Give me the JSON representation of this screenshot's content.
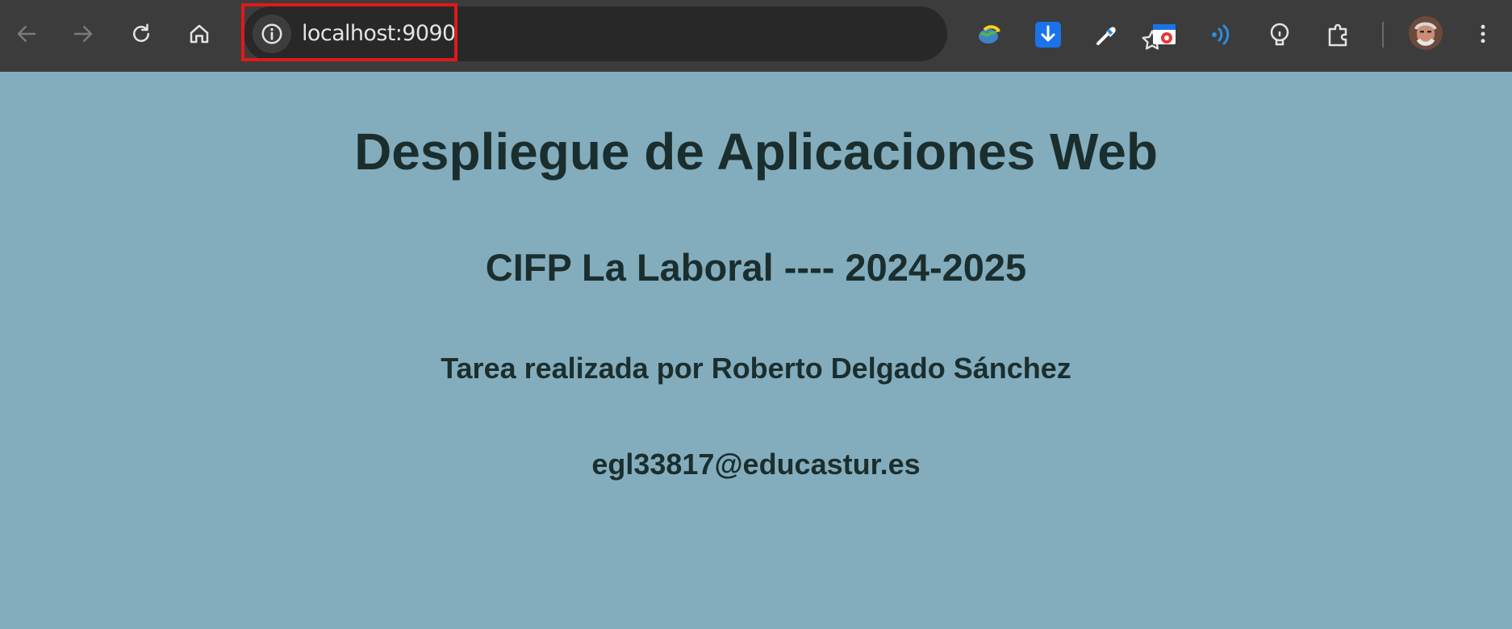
{
  "browser": {
    "url": "localhost:9090",
    "icons": {
      "back": "arrow-left-icon",
      "forward": "arrow-right-icon",
      "reload": "reload-icon",
      "home": "home-icon",
      "site_info": "info-icon",
      "bookmark": "star-icon",
      "extensions": [
        "globe-arrow-icon",
        "download-icon",
        "eyedropper-icon",
        "calendar-gear-icon",
        "wireless-icon",
        "lightbulb-icon",
        "puzzle-icon"
      ],
      "profile": "avatar",
      "menu": "kebab-menu-icon"
    },
    "highlight_color": "#e0191a"
  },
  "page": {
    "background": "#83adbd",
    "text_color": "#1b2e2e",
    "title": "Despliegue de Aplicaciones Web",
    "subtitle": "CIFP La Laboral ---- 2024-2025",
    "author": "Tarea realizada por Roberto Delgado Sánchez",
    "email": "egl33817@educastur.es"
  }
}
